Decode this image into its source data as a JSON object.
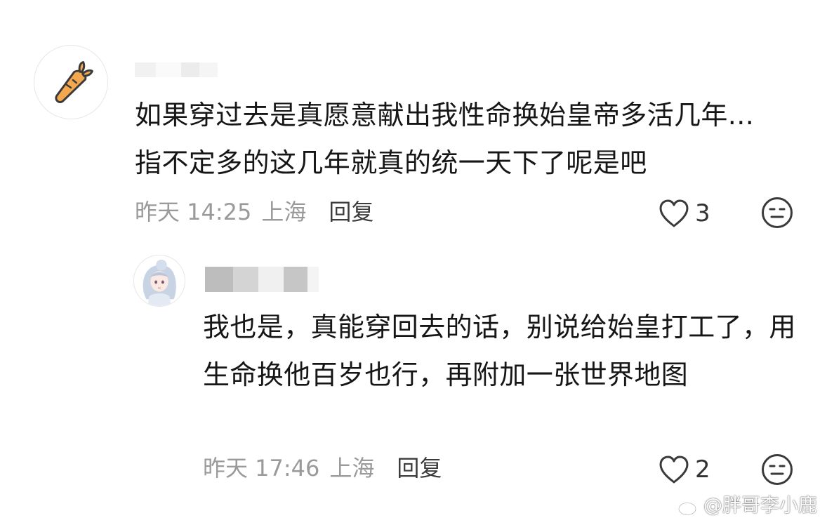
{
  "comments": [
    {
      "avatar_icon": "carrot-icon",
      "text": "如果穿过去是真愿意献出我性命换始皇帝多活几年...指不定多的这几年就真的统一天下了呢是吧",
      "time": "昨天 14:25",
      "location": "上海",
      "reply_label": "回复",
      "likes": "3"
    },
    {
      "avatar_icon": "anime-girl-avatar",
      "text": "我也是，真能穿回去的话，别说给始皇打工了，用生命换他百岁也行，再附加一张世界地图",
      "time": "昨天 17:46",
      "location": "上海",
      "reply_label": "回复",
      "likes": "2"
    }
  ],
  "icons": {
    "like": "heart-outline-icon",
    "dislike": "neutral-face-icon"
  },
  "watermark": {
    "text": "@胖哥李小鹿",
    "icon": "weibo-icon"
  },
  "colors": {
    "text": "#161616",
    "meta": "#9a9a9a",
    "reply": "#3c3c3c",
    "carrot": "#f3a74f",
    "carrot_leaf": "#3a3a3a"
  }
}
